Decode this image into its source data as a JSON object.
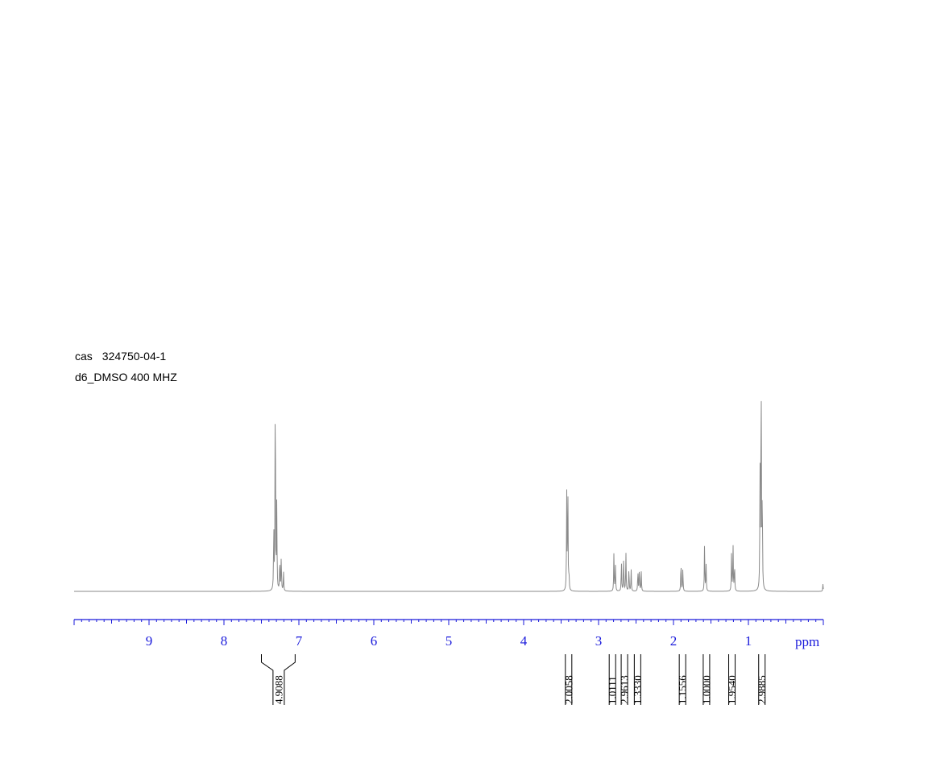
{
  "header": {
    "cas_label": "cas",
    "cas_number": "324750-04-1",
    "solvent_freq": "d6_DMSO  400 MHZ"
  },
  "chart_data": {
    "type": "line",
    "title": "",
    "xlabel": "ppm",
    "ylabel": "",
    "x_reversed": true,
    "xlim": [
      10.0,
      0.0
    ],
    "ylim": [
      0,
      1.0
    ],
    "grid": false,
    "ticks": [
      {
        "value": 9,
        "label": "9"
      },
      {
        "value": 8,
        "label": "8"
      },
      {
        "value": 7,
        "label": "7"
      },
      {
        "value": 6,
        "label": "6"
      },
      {
        "value": 5,
        "label": "5"
      },
      {
        "value": 4,
        "label": "4"
      },
      {
        "value": 3,
        "label": "3"
      },
      {
        "value": 2,
        "label": "2"
      },
      {
        "value": 1,
        "label": "1"
      }
    ],
    "peaks": [
      {
        "ppm": 7.335,
        "height": 0.27
      },
      {
        "ppm": 7.315,
        "height": 0.94
      },
      {
        "ppm": 7.295,
        "height": 0.36
      },
      {
        "ppm": 7.255,
        "height": 0.14
      },
      {
        "ppm": 7.235,
        "height": 0.15
      },
      {
        "ppm": 7.205,
        "height": 0.08
      },
      {
        "ppm": 3.425,
        "height": 0.4
      },
      {
        "ppm": 3.41,
        "height": 0.43
      },
      {
        "ppm": 3.395,
        "height": 0.07
      },
      {
        "ppm": 2.795,
        "height": 0.16
      },
      {
        "ppm": 2.775,
        "height": 0.11
      },
      {
        "ppm": 2.695,
        "height": 0.13
      },
      {
        "ppm": 2.665,
        "height": 0.15
      },
      {
        "ppm": 2.635,
        "height": 0.16
      },
      {
        "ppm": 2.595,
        "height": 0.1
      },
      {
        "ppm": 2.565,
        "height": 0.09
      },
      {
        "ppm": 2.475,
        "height": 0.09
      },
      {
        "ppm": 2.455,
        "height": 0.1
      },
      {
        "ppm": 2.43,
        "height": 0.08
      },
      {
        "ppm": 1.9,
        "height": 0.13
      },
      {
        "ppm": 1.875,
        "height": 0.1
      },
      {
        "ppm": 1.585,
        "height": 0.2
      },
      {
        "ppm": 1.565,
        "height": 0.11
      },
      {
        "ppm": 1.225,
        "height": 0.16
      },
      {
        "ppm": 1.205,
        "height": 0.19
      },
      {
        "ppm": 1.185,
        "height": 0.12
      },
      {
        "ppm": 0.845,
        "height": 0.5
      },
      {
        "ppm": 0.83,
        "height": 0.99
      },
      {
        "ppm": 0.815,
        "height": 0.42
      },
      {
        "ppm": 0.005,
        "height": 0.03
      }
    ],
    "integrals": [
      {
        "from": 7.5,
        "to": 7.05,
        "center": 7.27,
        "value": "4.9088"
      },
      {
        "from": 3.55,
        "to": 3.2,
        "center": 3.4,
        "value": "2.0058"
      },
      {
        "from": 2.9,
        "to": 2.75,
        "center": 2.815,
        "value": "1.0111"
      },
      {
        "from": 2.75,
        "to": 2.55,
        "center": 2.655,
        "value": "2.9613"
      },
      {
        "from": 2.55,
        "to": 2.4,
        "center": 2.48,
        "value": "1.3330"
      },
      {
        "from": 2.0,
        "to": 1.75,
        "center": 1.88,
        "value": "1.1556"
      },
      {
        "from": 1.75,
        "to": 1.45,
        "center": 1.56,
        "value": "1.0000"
      },
      {
        "from": 1.45,
        "to": 1.1,
        "center": 1.22,
        "value": "1.9540"
      },
      {
        "from": 0.95,
        "to": 0.7,
        "center": 0.82,
        "value": "2.9885"
      }
    ]
  }
}
